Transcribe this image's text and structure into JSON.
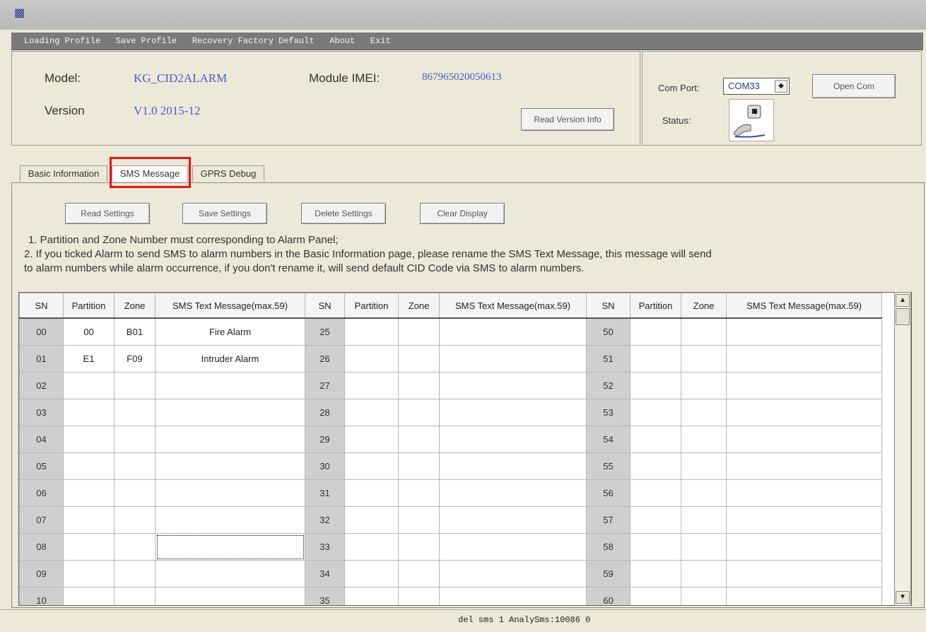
{
  "menu": [
    "Loading Profile",
    "Save Profile",
    "Recovery Factory Default",
    "About",
    "Exit"
  ],
  "info": {
    "model_label": "Model:",
    "model_value": "KG_CID2ALARM",
    "version_label": "Version",
    "version_value": "V1.0 2015-12",
    "imei_label": "Module IMEI:",
    "imei_value": "867965020050613",
    "read_version_btn": "Read Version Info"
  },
  "com": {
    "port_label": "Com Port:",
    "port_value": "COM33",
    "open_btn": "Open Com",
    "status_label": "Status:"
  },
  "tabs": [
    "Basic Information",
    "SMS Message",
    "GPRS Debug"
  ],
  "active_tab": "SMS Message",
  "actions": {
    "read": "Read Settings",
    "save": "Save Settings",
    "delete": "Delete Settings",
    "clear": "Clear Display"
  },
  "notes": {
    "line1": "1. Partition and Zone Number must corresponding to Alarm Panel;",
    "line2": "2. If you ticked Alarm to send SMS to alarm numbers in the Basic Information page, please rename the SMS Text Message, this message will send",
    "line3": "to alarm numbers while alarm occurrence, if you don't rename it, will send default CID Code via SMS to alarm numbers."
  },
  "table": {
    "headers": [
      "SN",
      "Partition",
      "Zone",
      "SMS Text Message(max.59)"
    ],
    "rows": [
      [
        "00",
        "00",
        "B01",
        "Fire Alarm",
        "25",
        "",
        "",
        "",
        "50",
        "",
        "",
        ""
      ],
      [
        "01",
        "E1",
        "F09",
        "Intruder Alarm",
        "26",
        "",
        "",
        "",
        "51",
        "",
        "",
        ""
      ],
      [
        "02",
        "",
        "",
        "",
        "27",
        "",
        "",
        "",
        "52",
        "",
        "",
        ""
      ],
      [
        "03",
        "",
        "",
        "",
        "28",
        "",
        "",
        "",
        "53",
        "",
        "",
        ""
      ],
      [
        "04",
        "",
        "",
        "",
        "29",
        "",
        "",
        "",
        "54",
        "",
        "",
        ""
      ],
      [
        "05",
        "",
        "",
        "",
        "30",
        "",
        "",
        "",
        "55",
        "",
        "",
        ""
      ],
      [
        "06",
        "",
        "",
        "",
        "31",
        "",
        "",
        "",
        "56",
        "",
        "",
        ""
      ],
      [
        "07",
        "",
        "",
        "",
        "32",
        "",
        "",
        "",
        "57",
        "",
        "",
        ""
      ],
      [
        "08",
        "",
        "",
        "",
        "33",
        "",
        "",
        "",
        "58",
        "",
        "",
        ""
      ],
      [
        "09",
        "",
        "",
        "",
        "34",
        "",
        "",
        "",
        "59",
        "",
        "",
        ""
      ],
      [
        "10",
        "",
        "",
        "",
        "35",
        "",
        "",
        "",
        "60",
        "",
        "",
        ""
      ]
    ]
  },
  "status_text": "del sms 1 AnalySms:10086 0"
}
